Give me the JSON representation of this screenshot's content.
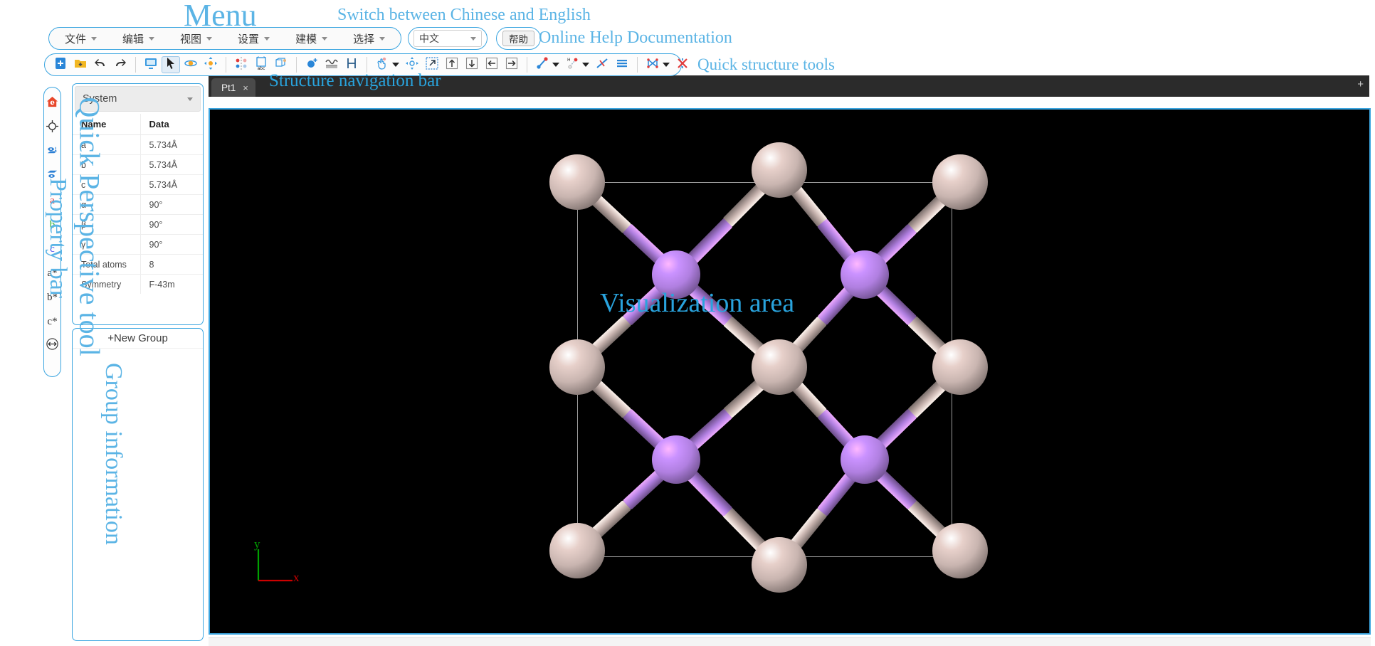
{
  "menu": {
    "items": [
      {
        "label": "文件",
        "name": "file"
      },
      {
        "label": "编辑",
        "name": "edit"
      },
      {
        "label": "视图",
        "name": "view"
      },
      {
        "label": "设置",
        "name": "settings"
      },
      {
        "label": "建模",
        "name": "modeling"
      },
      {
        "label": "选择",
        "name": "select"
      }
    ]
  },
  "language": {
    "value": "中文",
    "icon": "chevron-down-icon"
  },
  "help": {
    "label": "帮助"
  },
  "annotations": {
    "menu": "Menu",
    "language_switch": "Switch between Chinese and English",
    "online_help": "Online Help Documentation",
    "quick_structure_tools": "Quick structure tools",
    "structure_nav_bar": "Structure navigation bar",
    "visualization_area": "Visualization area",
    "quick_perspective_tool": "Quick Perspective tool",
    "property_bar": "Property bar",
    "group_information": "Group information"
  },
  "toolbar": {
    "groups": [
      {
        "buttons": [
          {
            "name": "new-file-button",
            "icon": "new-file-icon"
          },
          {
            "name": "open-file-button",
            "icon": "open-folder-icon"
          },
          {
            "name": "undo-button",
            "icon": "undo-arrow-icon"
          },
          {
            "name": "redo-button",
            "icon": "redo-arrow-icon"
          }
        ]
      },
      {
        "buttons": [
          {
            "name": "screen-refresh-button",
            "icon": "monitor-refresh-icon"
          },
          {
            "name": "select-cursor-button",
            "icon": "cursor-arrow-icon",
            "active": true
          },
          {
            "name": "rotate-button",
            "icon": "rotate-atom-icon"
          },
          {
            "name": "translate-button",
            "icon": "move-atom-icon"
          }
        ]
      },
      {
        "buttons": [
          {
            "name": "mirror-symmetry-button",
            "icon": "mirror-atoms-icon"
          },
          {
            "name": "label-atoms-button",
            "icon": "abc-box-icon"
          },
          {
            "name": "supercell-button",
            "icon": "supercell-icon"
          }
        ]
      },
      {
        "buttons": [
          {
            "name": "add-atom-button",
            "icon": "add-atom-icon"
          },
          {
            "name": "surface-slab-button",
            "icon": "slab-icon"
          },
          {
            "name": "measure-button",
            "icon": "h-bracket-icon"
          }
        ]
      },
      {
        "buttons": [
          {
            "name": "drag-atom-button",
            "icon": "hand-drag-icon",
            "caret": true
          },
          {
            "name": "anchor-move-button",
            "icon": "anchor-move-icon"
          },
          {
            "name": "expand-select-button",
            "icon": "expand-arrow-icon"
          },
          {
            "name": "move-up-button",
            "icon": "arrow-up-icon"
          },
          {
            "name": "move-down-button",
            "icon": "arrow-down-icon"
          },
          {
            "name": "move-left-button",
            "icon": "arrow-left-icon"
          },
          {
            "name": "move-right-button",
            "icon": "arrow-right-icon"
          }
        ]
      },
      {
        "buttons": [
          {
            "name": "add-bond-button",
            "icon": "bond-icon",
            "caret": true
          },
          {
            "name": "add-hydrogen-button",
            "icon": "hydrogen-bond-icon",
            "caret": true
          },
          {
            "name": "delete-bond-button",
            "icon": "cut-bond-icon"
          },
          {
            "name": "layer-button",
            "icon": "layers-icon"
          }
        ]
      },
      {
        "buttons": [
          {
            "name": "bond-network-button",
            "icon": "bond-network-icon",
            "caret": true
          },
          {
            "name": "delete-selection-button",
            "icon": "delete-cross-icon"
          }
        ]
      }
    ]
  },
  "perspective_rail": {
    "items": [
      {
        "name": "home-view",
        "label": "",
        "icon": "home-icon",
        "color": "#e8472a"
      },
      {
        "name": "center-view",
        "label": "",
        "icon": "crosshair-icon",
        "color": "#333333"
      },
      {
        "name": "plane-view-1",
        "label": "",
        "icon": "eye-plane-1-icon",
        "color": "#2b7fd4"
      },
      {
        "name": "plane-view-2",
        "label": "",
        "icon": "eye-plane-2-icon",
        "color": "#2b7fd4"
      },
      {
        "name": "axis-a",
        "label": "a",
        "icon": "axis-a-icon",
        "color": "#e02b2b"
      },
      {
        "name": "axis-b",
        "label": "b",
        "icon": "axis-b-icon",
        "color": "#2fb02f"
      },
      {
        "name": "axis-c",
        "label": "c",
        "icon": "axis-c-icon",
        "color": "#4d4df0"
      },
      {
        "name": "axis-a-star",
        "label": "a*",
        "icon": "axis-a-star-icon",
        "color": "#333333"
      },
      {
        "name": "axis-b-star",
        "label": "b*",
        "icon": "axis-b-star-icon",
        "color": "#333333"
      },
      {
        "name": "axis-c-star",
        "label": "c*",
        "icon": "axis-c-star-icon",
        "color": "#333333"
      },
      {
        "name": "toggle-view",
        "label": "",
        "icon": "swap-arrows-icon",
        "color": "#333333"
      }
    ]
  },
  "property_panel": {
    "selector": {
      "value": "System",
      "icon": "chevron-down-icon"
    },
    "headers": [
      "Name",
      "Data"
    ],
    "rows": [
      {
        "name": "a",
        "value": "5.734Å"
      },
      {
        "name": "b",
        "value": "5.734Å"
      },
      {
        "name": "c",
        "value": "5.734Å"
      },
      {
        "name": "α",
        "value": "90°"
      },
      {
        "name": "β",
        "value": "90°"
      },
      {
        "name": "γ",
        "value": "90°"
      },
      {
        "name": "Total atoms",
        "value": "8"
      },
      {
        "name": "Symmetry",
        "value": "F-43m"
      }
    ]
  },
  "group_panel": {
    "new_group_label": "+New Group"
  },
  "tabs": {
    "items": [
      {
        "label": "Pt1",
        "close": "×"
      }
    ],
    "add_label": "+"
  },
  "viewport": {
    "background": "#000000",
    "axis": {
      "x_label": "x",
      "x_color": "#cc0000",
      "y_label": "y",
      "y_color": "#00a000"
    },
    "atom_colors": {
      "tan": "#c9b5b0",
      "purple": "#b07fe0"
    },
    "cell_outline_color": "#cfcfcf"
  },
  "colors": {
    "accent": "#3aa5e0",
    "annotation": "#5bb4e5",
    "annotation_strong": "#29a3dd"
  }
}
